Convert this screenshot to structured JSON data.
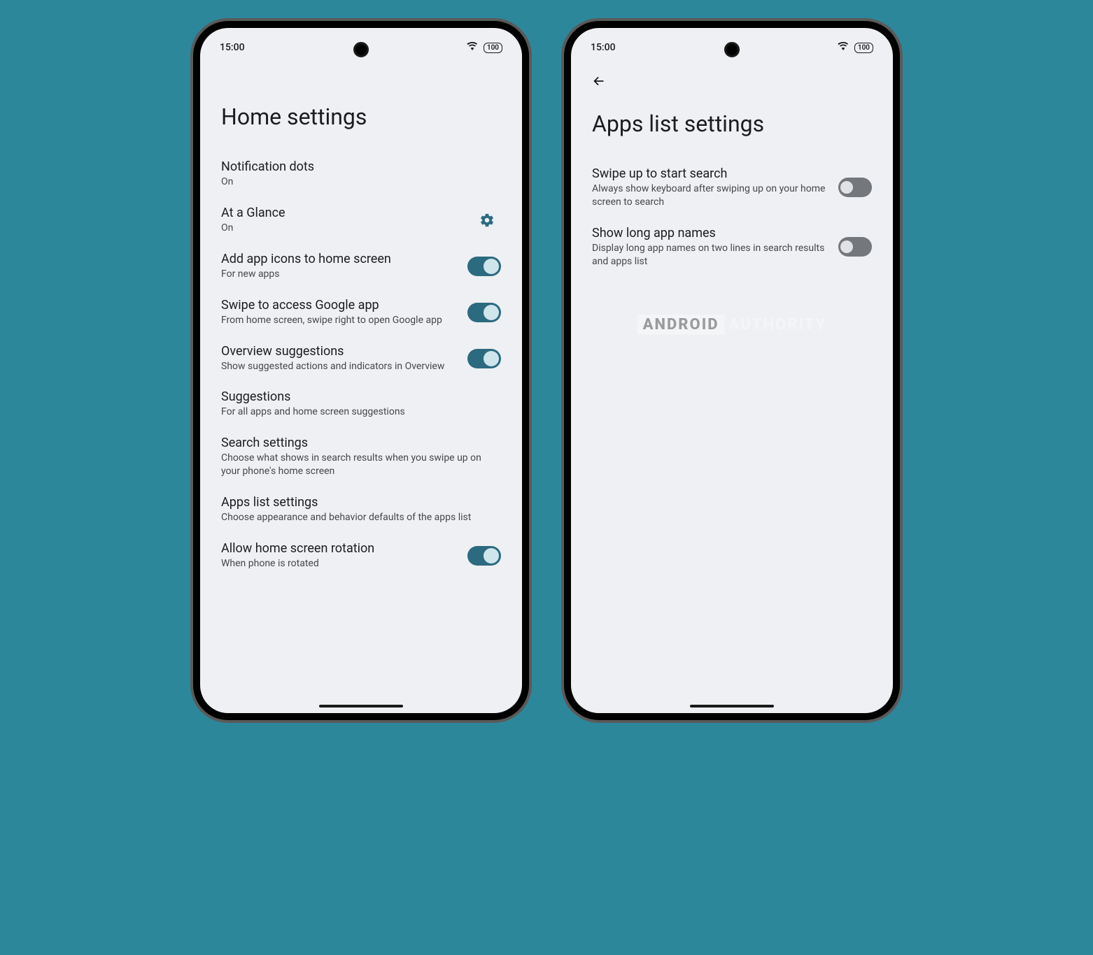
{
  "status": {
    "time": "15:00",
    "battery": "100"
  },
  "left": {
    "title": "Home settings",
    "items": [
      {
        "title": "Notification dots",
        "sub": "On",
        "type": "link"
      },
      {
        "title": "At a Glance",
        "sub": "On",
        "type": "gear"
      },
      {
        "title": "Add app icons to home screen",
        "sub": "For new apps",
        "type": "toggle",
        "on": true
      },
      {
        "title": "Swipe to access Google app",
        "sub": "From home screen, swipe right to open Google app",
        "type": "toggle",
        "on": true
      },
      {
        "title": "Overview suggestions",
        "sub": "Show suggested actions and indicators in Overview",
        "type": "toggle",
        "on": true
      },
      {
        "title": "Suggestions",
        "sub": "For all apps and home screen suggestions",
        "type": "link"
      },
      {
        "title": "Search settings",
        "sub": "Choose what shows in search results when you swipe up on your phone's home screen",
        "type": "link"
      },
      {
        "title": "Apps list settings",
        "sub": "Choose appearance and behavior defaults of the apps list",
        "type": "link"
      },
      {
        "title": "Allow home screen rotation",
        "sub": "When phone is rotated",
        "type": "toggle",
        "on": true
      }
    ]
  },
  "right": {
    "title": "Apps list settings",
    "items": [
      {
        "title": "Swipe up to start search",
        "sub": "Always show keyboard after swiping up on your home screen to search",
        "type": "toggle",
        "on": false
      },
      {
        "title": "Show long app names",
        "sub": "Display long app names on two lines in search results and apps list",
        "type": "toggle",
        "on": false
      }
    ]
  },
  "watermark": {
    "a": "ANDROID",
    "b": "AUTHORITY"
  }
}
